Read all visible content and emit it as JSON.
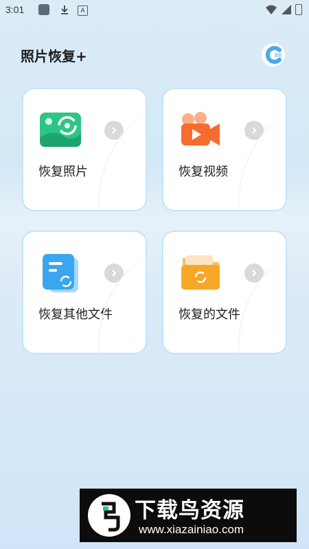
{
  "status_bar": {
    "time": "3:01",
    "icons": [
      "notification-square-icon",
      "download-icon",
      "font-a-icon",
      "wifi-icon",
      "signal-icon",
      "battery-icon"
    ]
  },
  "header": {
    "title": "照片恢复+",
    "logo_icon": "app-logo-c-icon"
  },
  "cards": [
    {
      "label": "恢复照片",
      "icon": "photo-restore-icon",
      "color": "#2ec584"
    },
    {
      "label": "恢复视频",
      "icon": "video-camera-icon",
      "color": "#f76b2e"
    },
    {
      "label": "恢复其他文件",
      "icon": "document-restore-icon",
      "color": "#3aa6ef"
    },
    {
      "label": "恢复的文件",
      "icon": "folder-restore-icon",
      "color": "#f7a727"
    }
  ],
  "watermark": {
    "brand_text": "下载鸟资源",
    "url": "www.xiazainiao.com"
  },
  "colors": {
    "card_border": "#c6e4f6",
    "arrow_bg": "#d9d9d9",
    "text": "#1d1d1d"
  }
}
